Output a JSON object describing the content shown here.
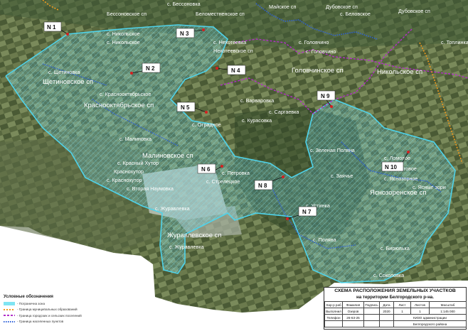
{
  "colors": {
    "satellite_base": "#3d5233",
    "fields_light": "#8e9a78",
    "urban": "#b8c0b6",
    "hatch": "#7fe4f3",
    "boundary_cyan": "#4fd3ea",
    "boundary_blue": "#2f62d8",
    "boundary_magenta": "#b22fc8",
    "boundary_orange": "#f09a1e",
    "marker_red": "#d42020"
  },
  "place_labels": [
    "с. Бессоновка",
    "Бессоновское сп",
    "Беломестненское сп",
    "Майское сп",
    "Дубовское сп",
    "с. Беловское",
    "Дубовское сп",
    "с. Никольское",
    "с. Никольское",
    "с. Щетиновка",
    "Щетиновское сп",
    "с. Краснооктябрьское",
    "Краснооктябрьское сп",
    "с. Нехотеевка",
    "Нехотеевское сп",
    "с. Головчино",
    "с. Головчино",
    "с. Топлинка",
    "Головчинское сп",
    "Никольское сп",
    "с. Варваровка",
    "с. Саргаевка",
    "с. Курасовка",
    "с. Отрадное",
    "Малиновское сп",
    "с. Малиновка",
    "Краснохутор",
    "с. Краснохутор",
    "с. Петровка",
    "с. Стрелецкое",
    "с. Журавлевка",
    "Журавлевское сп",
    "с. Журавлевка",
    "с. Яснозорное",
    "Яснозоренское сп",
    "с. Ясные зори",
    "с. Устинка",
    "с. Поляна",
    "с. Бирюлька",
    "с. Соколовка",
    "с. Ломовое",
    "с. Заячье",
    "с. Зеленая Поляна",
    "с. Вторая Наумовка",
    "с. Красный Хутор",
    "с. Кустовое"
  ],
  "markers": [
    {
      "id": "N 1"
    },
    {
      "id": "N 2"
    },
    {
      "id": "N 3"
    },
    {
      "id": "N 4"
    },
    {
      "id": "N 5"
    },
    {
      "id": "N 6"
    },
    {
      "id": "N 7"
    },
    {
      "id": "N 8"
    },
    {
      "id": "N 9"
    },
    {
      "id": "N 10"
    }
  ],
  "legend": {
    "title": "Условные обозначения",
    "items": [
      {
        "label": "- Погранична зона",
        "color": "#7fe4f3"
      },
      {
        "label": "- Граница муниципальных образований",
        "color": "#f09a1e"
      },
      {
        "label": "- Граница городских и сельских поселений",
        "color": "#b22fc8"
      },
      {
        "label": "- Граница населенных пунктов",
        "color": "#2f62d8"
      }
    ]
  },
  "title_block": {
    "title": "СХЕМА РАСПОЛОЖЕНИЯ ЗЕМЕЛЬНЫХ УЧАСТКОВ",
    "subtitle": "на территории Белгородского р-на.",
    "rows": [
      [
        "Хар-р раб",
        "Фамилия",
        "Подпись",
        "Дата",
        "Лист",
        "Листов",
        "Масштаб"
      ],
      [
        "Выполнил",
        "Озеров",
        "",
        "2020",
        "1",
        "1",
        "1:145 000"
      ],
      [
        "Телефон",
        "26-63-25",
        "",
        "",
        "КИЗО администрации",
        "",
        ""
      ],
      [
        "",
        "",
        "",
        "",
        "Белгородского района",
        "",
        ""
      ]
    ]
  }
}
